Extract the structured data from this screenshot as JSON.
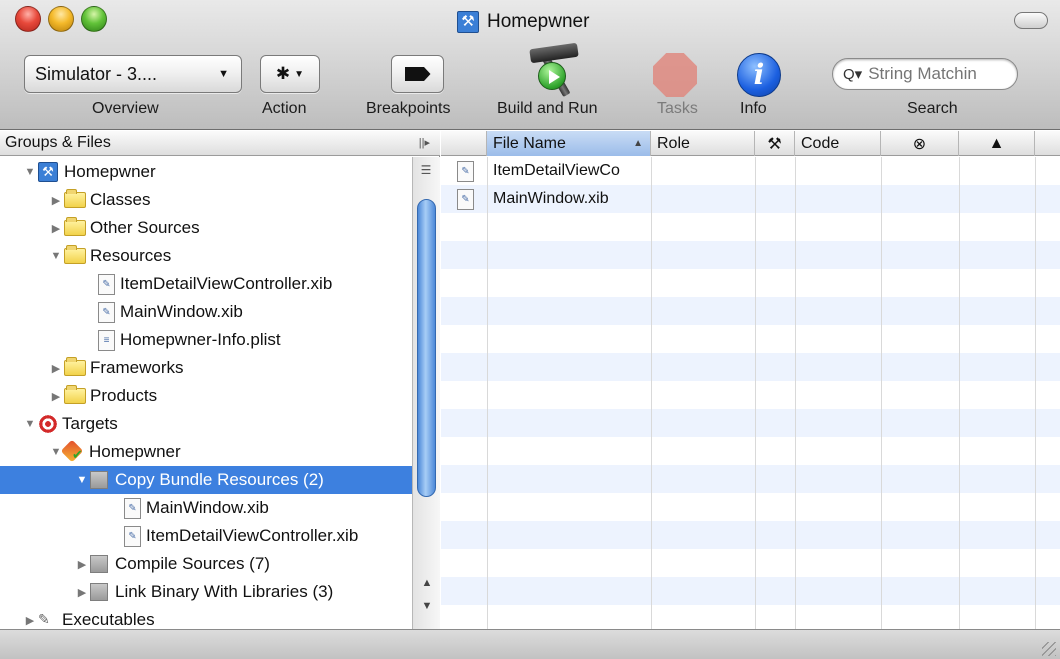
{
  "window": {
    "title": "Homepwner"
  },
  "toolbar": {
    "scheme_popup": "Simulator - 3....",
    "labels": {
      "overview": "Overview",
      "action": "Action",
      "breakpoints": "Breakpoints",
      "build_and_run": "Build and Run",
      "tasks": "Tasks",
      "info": "Info",
      "search": "Search"
    },
    "search_placeholder": "String Matchin",
    "info_glyph": "i"
  },
  "groups_header": "Groups & Files",
  "tree": [
    {
      "label": "Homepwner",
      "icon": "project-icon",
      "expanded": true
    },
    {
      "label": "Classes",
      "icon": "folder-icon",
      "expanded": false
    },
    {
      "label": "Other Sources",
      "icon": "folder-icon",
      "expanded": false
    },
    {
      "label": "Resources",
      "icon": "folder-icon",
      "expanded": true
    },
    {
      "label": "ItemDetailViewController.xib",
      "icon": "xib-file-icon"
    },
    {
      "label": "MainWindow.xib",
      "icon": "xib-file-icon"
    },
    {
      "label": "Homepwner-Info.plist",
      "icon": "plist-file-icon"
    },
    {
      "label": "Frameworks",
      "icon": "folder-icon",
      "expanded": false
    },
    {
      "label": "Products",
      "icon": "folder-icon",
      "expanded": false
    },
    {
      "label": "Targets",
      "icon": "target-icon",
      "expanded": true
    },
    {
      "label": "Homepwner",
      "icon": "app-target-icon",
      "expanded": true
    },
    {
      "label": "Copy Bundle Resources (2)",
      "icon": "build-phase-icon",
      "expanded": true,
      "selected": true
    },
    {
      "label": "MainWindow.xib",
      "icon": "xib-file-icon"
    },
    {
      "label": "ItemDetailViewController.xib",
      "icon": "xib-file-icon"
    },
    {
      "label": "Compile Sources (7)",
      "icon": "build-phase-icon",
      "expanded": false
    },
    {
      "label": "Link Binary With Libraries (3)",
      "icon": "build-phase-icon",
      "expanded": false
    },
    {
      "label": "Executables",
      "icon": "executables-icon",
      "expanded": false
    }
  ],
  "file_table": {
    "columns": [
      "File Name",
      "Role",
      "",
      "Code",
      "",
      ""
    ],
    "column_icons": [
      "",
      "",
      "hammer-icon",
      "",
      "error-icon",
      "warning-icon"
    ],
    "rows": [
      {
        "name": "ItemDetailViewCo",
        "role": "",
        "code": ""
      },
      {
        "name": "MainWindow.xib",
        "role": "",
        "code": ""
      }
    ]
  },
  "colors": {
    "selection": "#3d80df",
    "row_stripe": "#edf3fe",
    "sort_header": "#9bbce9"
  }
}
